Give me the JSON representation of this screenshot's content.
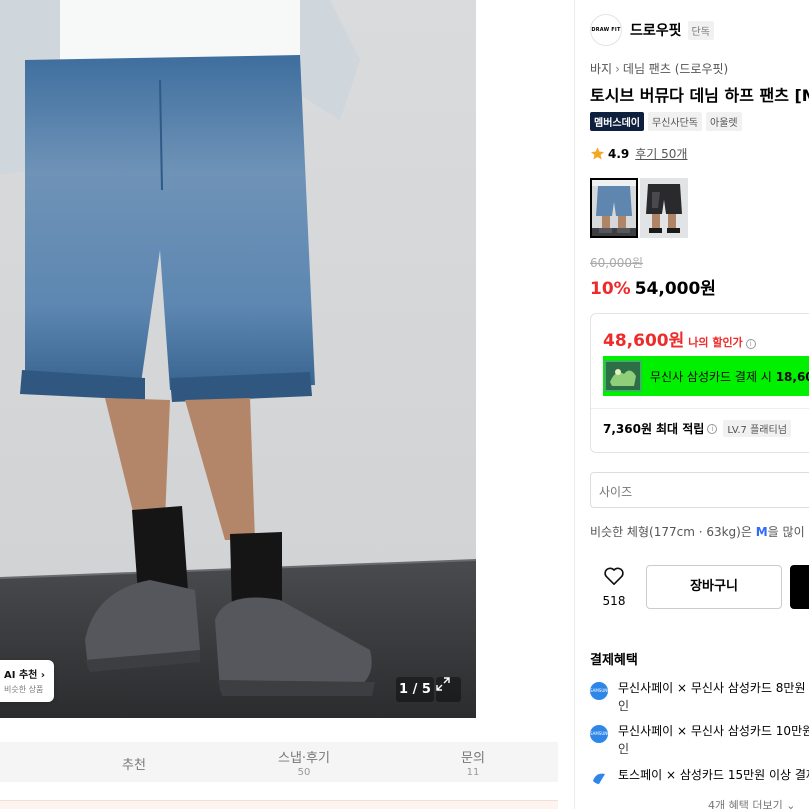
{
  "image": {
    "ai_label": "AI 추천",
    "ai_sub": "비슷한 상품",
    "counter": "1 / 5"
  },
  "tabs": [
    {
      "label": "추천",
      "count": ""
    },
    {
      "label": "스냅·후기",
      "count": "50"
    },
    {
      "label": "문의",
      "count": "11"
    }
  ],
  "brand": {
    "logo_text": "DRAW FIT",
    "name": "드로우핏",
    "badge": "단독"
  },
  "breadcrumb": [
    "바지",
    "데님 팬츠 (드로우핏)"
  ],
  "product": {
    "title": "토시브 버뮤다 데님 하프 팬츠 [M",
    "tags": [
      "멤버스데이",
      "무신사단독",
      "아울렛"
    ],
    "rating": "4.9",
    "reviews": "후기 50개",
    "original_price": "60,000원",
    "discount": "10%",
    "price": "54,000원"
  },
  "benefits": {
    "my_price": "48,600원",
    "my_price_label": "나의 할인가",
    "card_text": "무신사 삼성카드 결제 시",
    "card_amount": "18,60",
    "points": "7,360원",
    "points_label": "최대 적립",
    "level": "LV.7 플래티넘"
  },
  "size_placeholder": "사이즈",
  "similar": {
    "pre": "비슷한 체형(177cm · 63kg)은",
    "size": "M",
    "post": "을 많이 구"
  },
  "likes": "518",
  "cart_label": "장바구니",
  "payment": {
    "title": "결제혜택",
    "items": [
      {
        "icon": "samsung-card-icon",
        "line1": "무신사페이 × 무신사 삼성카드 8만원",
        "line2": "인"
      },
      {
        "icon": "samsung-card-icon",
        "line1": "무신사페이 × 무신사 삼성카드 10만원",
        "line2": "인"
      },
      {
        "icon": "toss-icon",
        "line1": "토스페이 × 삼성카드 15만원 이상 결제",
        "line2": ""
      }
    ],
    "more": "4개 혜택 더보기"
  },
  "colors": {
    "accent_red": "#ef2a2a",
    "card_banner": "#00f000",
    "tag_dark": "#0f1f3e",
    "size_blue": "#2f6bff"
  }
}
